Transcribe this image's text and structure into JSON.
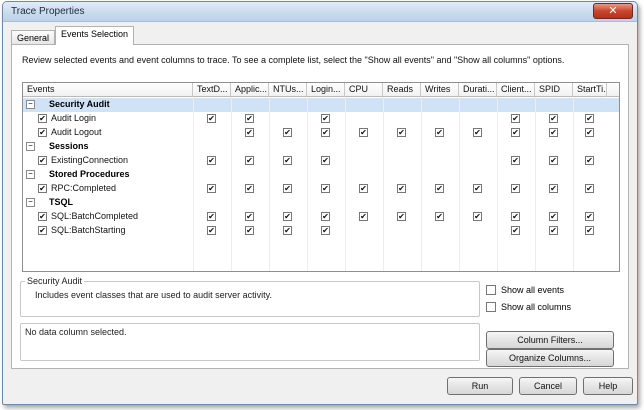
{
  "window": {
    "title": "Trace Properties",
    "close_glyph": "✕"
  },
  "tabs": [
    {
      "label": "General"
    },
    {
      "label": "Events Selection"
    }
  ],
  "description": "Review selected events and event columns to trace. To see a complete list, select the \"Show all events\" and \"Show all columns\" options.",
  "grid": {
    "columns": [
      "Events",
      "TextD...",
      "Applic...",
      "NTUs...",
      "Login...",
      "CPU",
      "Reads",
      "Writes",
      "Durati...",
      "Client...",
      "SPID",
      "StartTi..."
    ],
    "rows": [
      {
        "kind": "category",
        "label": "Security Audit",
        "expander": "−",
        "selected": true
      },
      {
        "kind": "event",
        "label": "Audit Login",
        "checked": true,
        "cells": [
          1,
          1,
          0,
          1,
          0,
          0,
          0,
          0,
          1,
          1,
          1
        ]
      },
      {
        "kind": "event",
        "label": "Audit Logout",
        "checked": true,
        "cells": [
          0,
          1,
          1,
          1,
          1,
          1,
          1,
          1,
          1,
          1,
          1
        ]
      },
      {
        "kind": "category",
        "label": "Sessions",
        "expander": "−",
        "selected": false
      },
      {
        "kind": "event",
        "label": "ExistingConnection",
        "checked": true,
        "cells": [
          1,
          1,
          1,
          1,
          0,
          0,
          0,
          0,
          1,
          1,
          1
        ]
      },
      {
        "kind": "category",
        "label": "Stored Procedures",
        "expander": "−",
        "selected": false
      },
      {
        "kind": "event",
        "label": "RPC:Completed",
        "checked": true,
        "cells": [
          1,
          1,
          1,
          1,
          1,
          1,
          1,
          1,
          1,
          1,
          1
        ]
      },
      {
        "kind": "category",
        "label": "TSQL",
        "expander": "−",
        "selected": false
      },
      {
        "kind": "event",
        "label": "SQL:BatchCompleted",
        "checked": true,
        "cells": [
          1,
          1,
          1,
          1,
          1,
          1,
          1,
          1,
          1,
          1,
          1
        ]
      },
      {
        "kind": "event",
        "label": "SQL:BatchStarting",
        "checked": true,
        "cells": [
          1,
          1,
          1,
          1,
          0,
          0,
          0,
          0,
          1,
          1,
          1
        ]
      }
    ],
    "check_glyph": "✔"
  },
  "event_info": {
    "title": "Security Audit",
    "text": "Includes event classes that are used to audit server activity."
  },
  "column_info": {
    "text": "No data column selected."
  },
  "options": {
    "show_all_events": "Show all events",
    "show_all_columns": "Show all columns"
  },
  "buttons": {
    "column_filters": "Column Filters...",
    "organize_columns": "Organize Columns...",
    "run": "Run",
    "cancel": "Cancel",
    "help": "Help"
  }
}
